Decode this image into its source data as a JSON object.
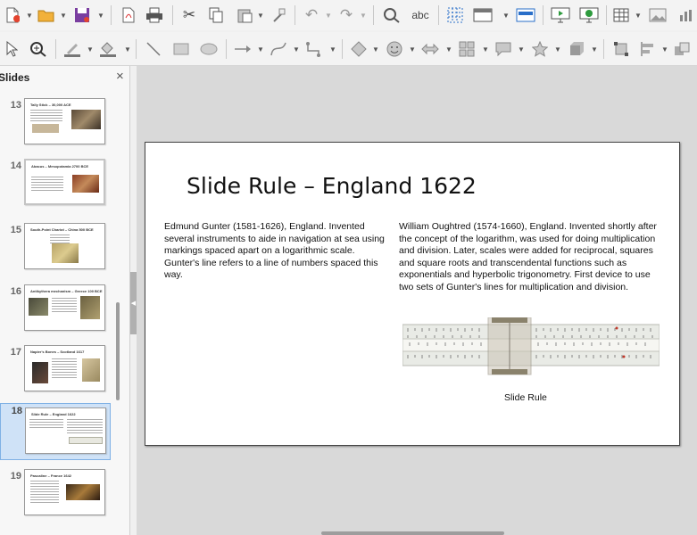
{
  "toolbar_main": {
    "icons": [
      "new-icon",
      "open-icon",
      "save-icon",
      "export-pdf-icon",
      "print-icon",
      "cut-icon",
      "copy-icon",
      "paste-icon",
      "clone-formatting-icon",
      "undo-icon",
      "redo-icon",
      "find-replace-icon",
      "spelling-icon",
      "grid-icon",
      "display-views-icon",
      "master-slide-icon",
      "start-first-slide-icon",
      "start-current-slide-icon",
      "table-icon",
      "image-icon"
    ]
  },
  "toolbar_draw": {
    "icons": [
      "select-icon",
      "zoom-pan-icon",
      "line-color-icon",
      "fill-color-icon",
      "line-icon",
      "rectangle-icon",
      "ellipse-icon",
      "lines-arrows-icon",
      "curves-icon",
      "connectors-icon",
      "basic-shapes-icon",
      "symbol-shapes-icon",
      "block-arrows-icon",
      "flowchart-icon",
      "callouts-icon",
      "stars-icon",
      "3d-objects-icon",
      "transformations-icon",
      "align-icon",
      "arrange-icon"
    ]
  },
  "slides_panel": {
    "title": "Slides",
    "close_glyph": "×",
    "items": [
      {
        "number": "13",
        "title": "Tally Stick – 30,000 ACE",
        "active": false
      },
      {
        "number": "14",
        "title": "Abacus – Mesopotamia 2700 BCE",
        "active": false
      },
      {
        "number": "15",
        "title": "South-Point Chariot – China 500 BCE",
        "active": false
      },
      {
        "number": "16",
        "title": "Antikythera mechanism – Greece 100 BCE",
        "active": false
      },
      {
        "number": "17",
        "title": "Napier's Bones – Scotland 1617",
        "active": false
      },
      {
        "number": "18",
        "title": "Slide Rule – England 1622",
        "active": true
      },
      {
        "number": "19",
        "title": "Pascaline – France 1642",
        "active": false
      }
    ]
  },
  "slide": {
    "title": "Slide Rule – England 1622",
    "left_text": "Edmund Gunter (1581-1626), England. Invented several instruments to aide in navigation at sea using markings spaced apart on a logarithmic scale. Gunter's line refers to a line of numbers spaced this way.",
    "right_text": "William Oughtred (1574-1660), England. Invented shortly after the concept of the logarithm, was used for doing multiplication and division. Later, scales were added for reciprocal, squares and square roots and transcendental functions such as exponentials and hyperbolic trigonometry. First device to use two sets of Gunter's lines for multiplication and division.",
    "image_caption": "Slide Rule"
  },
  "colors": {
    "selected_thumb_bg": "#cfe2f7",
    "selected_thumb_border": "#7fb1e5",
    "workspace_bg": "#d9d9d9"
  }
}
